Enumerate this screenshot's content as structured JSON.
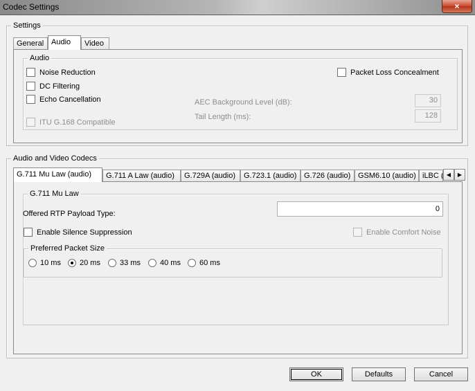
{
  "window": {
    "title": "Codec Settings",
    "close_icon": "×"
  },
  "settings": {
    "group_title": "Settings",
    "tabs": [
      {
        "label": "General",
        "active": false
      },
      {
        "label": "Audio",
        "active": true
      },
      {
        "label": "Video",
        "active": false
      }
    ],
    "audio": {
      "group_title": "Audio",
      "noise_reduction": {
        "label": "Noise Reduction",
        "checked": false
      },
      "dc_filtering": {
        "label": "DC Filtering",
        "checked": false
      },
      "echo_cancellation": {
        "label": "Echo Cancellation",
        "checked": false
      },
      "itu_g168": {
        "label": "ITU G.168 Compatible",
        "checked": false,
        "enabled": false
      },
      "packet_loss_concealment": {
        "label": "Packet Loss Concealment",
        "checked": false
      },
      "aec_background_level": {
        "label": "AEC Background Level (dB):",
        "value": "30"
      },
      "tail_length": {
        "label": "Tail Length (ms):",
        "value": "128"
      }
    }
  },
  "codecs": {
    "group_title": "Audio and Video Codecs",
    "tabs": [
      {
        "label": "G.711 Mu Law (audio)",
        "active": true
      },
      {
        "label": "G.711 A Law (audio)",
        "active": false
      },
      {
        "label": "G.729A (audio)",
        "active": false
      },
      {
        "label": "G.723.1 (audio)",
        "active": false
      },
      {
        "label": "G.726 (audio)",
        "active": false
      },
      {
        "label": "GSM6.10 (audio)",
        "active": false
      },
      {
        "label": "iLBC (a",
        "active": false
      }
    ],
    "scroll_left_icon": "◀",
    "scroll_right_icon": "▶",
    "panel": {
      "group_title": "G.711 Mu Law",
      "payload_type_label": "Offered RTP Payload Type:",
      "payload_type_value": "0",
      "silence_suppression": {
        "label": "Enable Silence Suppression",
        "checked": false
      },
      "comfort_noise": {
        "label": "Enable Comfort Noise",
        "checked": false,
        "enabled": false
      },
      "packet_size": {
        "group_title": "Preferred Packet Size",
        "options": [
          {
            "label": "10 ms",
            "checked": false
          },
          {
            "label": "20 ms",
            "checked": true
          },
          {
            "label": "33 ms",
            "checked": false
          },
          {
            "label": "40 ms",
            "checked": false
          },
          {
            "label": "60 ms",
            "checked": false
          }
        ]
      }
    }
  },
  "buttons": {
    "ok": "OK",
    "defaults": "Defaults",
    "cancel": "Cancel"
  }
}
